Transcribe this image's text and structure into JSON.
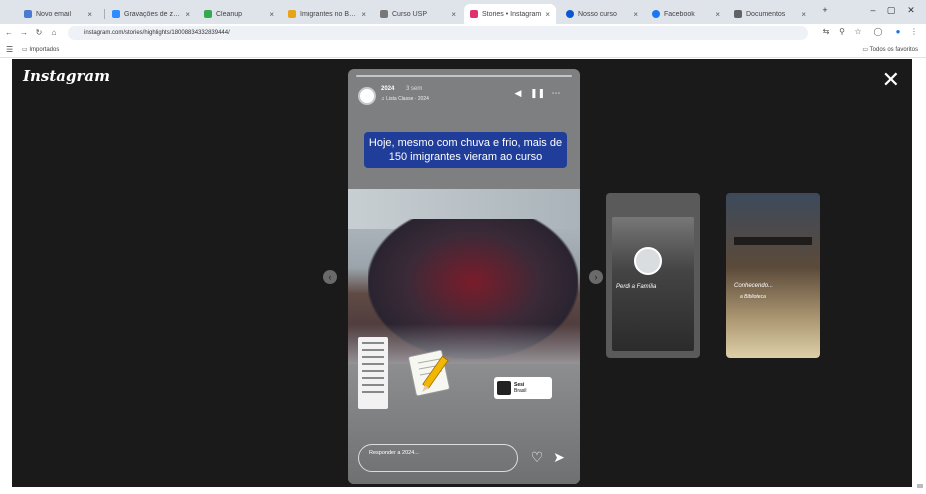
{
  "browser": {
    "tabs": [
      {
        "title": "Novo email",
        "favicon_color": "#4a7bd0"
      },
      {
        "title": "Gravações de zoom",
        "favicon_color": "#2d8cff"
      },
      {
        "title": "Cleanup",
        "favicon_color": "#34a853"
      },
      {
        "title": "Imigrantes no Brasil",
        "favicon_color": "#e8a317"
      },
      {
        "title": "Curso USP",
        "favicon_color": "#777777"
      },
      {
        "title": "Stories • Instagram",
        "favicon_color": "#e1306c",
        "active": true
      },
      {
        "title": "Nosso curso",
        "favicon_color": "#0b57d0"
      },
      {
        "title": "Facebook",
        "favicon_color": "#1877f2"
      },
      {
        "title": "Documentos",
        "favicon_color": "#5f6368"
      }
    ],
    "url": "instagram.com/stories/highlights/18008834332839444/",
    "bookmarks_label": "Todos os favoritos",
    "bookmark_folder": "Importados",
    "window_buttons": [
      "–",
      "▢",
      "✕"
    ]
  },
  "instagram": {
    "logo": "Instagram",
    "close_label": "✕",
    "story": {
      "username": "2024",
      "time": "3 sem",
      "music": "♫ Lista Classe · 2024",
      "caption": "Hoje, mesmo com chuva e frio, mais de 150 imigrantes vieram ao curso",
      "mention_name": "Sesi",
      "mention_sub": "Brasil",
      "reply_placeholder": "Responder a 2024..."
    },
    "previews": [
      {
        "title": "Perdi a Família"
      },
      {
        "title": "Conhecendo...",
        "subtitle": "a Biblioteca"
      }
    ],
    "accent_colors": {
      "caption_bg": "#203d9a",
      "viewer_bg": "#1a1a1a"
    }
  },
  "icons": {
    "close": "close-icon",
    "heart": "heart-icon",
    "send": "send-icon",
    "pause": "pause-icon",
    "mute": "mute-icon",
    "more": "more-icon",
    "prev": "chevron-left-icon",
    "next": "chevron-right-icon"
  }
}
